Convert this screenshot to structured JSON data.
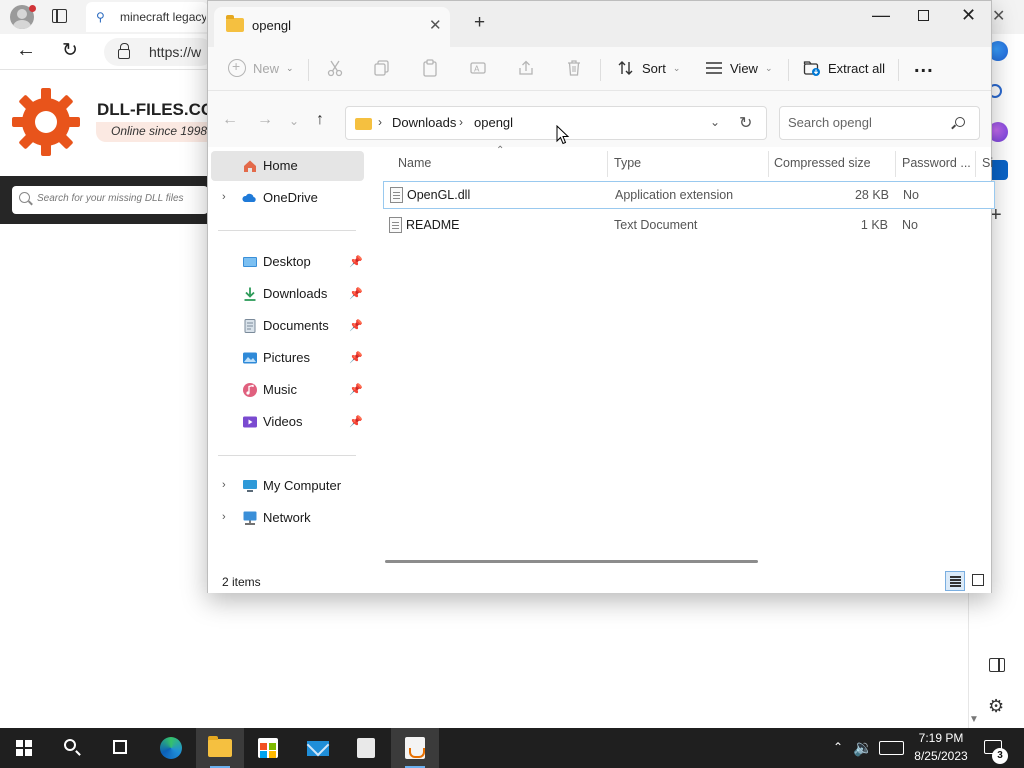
{
  "browser": {
    "tab_title": "minecraft legacy",
    "url": "https://w",
    "site": {
      "name": "DLL-FILES.COM",
      "tagline": "Online since 1998",
      "search_placeholder": "Search for your missing DLL files"
    }
  },
  "explorer": {
    "tab_title": "opengl",
    "toolbar": {
      "new_label": "New",
      "sort_label": "Sort",
      "view_label": "View",
      "extract_label": "Extract all",
      "more_label": "..."
    },
    "address": {
      "crumbs": [
        "Downloads",
        "opengl"
      ]
    },
    "search_placeholder": "Search opengl",
    "nav": {
      "home": "Home",
      "onedrive": "OneDrive",
      "quick_access": [
        {
          "label": "Desktop"
        },
        {
          "label": "Downloads"
        },
        {
          "label": "Documents"
        },
        {
          "label": "Pictures"
        },
        {
          "label": "Music"
        },
        {
          "label": "Videos"
        }
      ],
      "my_computer": "My Computer",
      "network": "Network"
    },
    "columns": {
      "name": "Name",
      "type": "Type",
      "compressed_size": "Compressed size",
      "password": "Password ...",
      "size_truncated": "Si"
    },
    "files": [
      {
        "name": "OpenGL.dll",
        "type": "Application extension",
        "compressed_size": "28 KB",
        "password": "No"
      },
      {
        "name": "README",
        "type": "Text Document",
        "compressed_size": "1 KB",
        "password": "No"
      }
    ],
    "status": "2 items"
  },
  "taskbar": {
    "time": "7:19 PM",
    "date": "8/25/2023",
    "notification_count": "3"
  },
  "colors": {
    "accent": "#0078d4",
    "folder": "#f5c040",
    "logo_orange": "#e8541b"
  }
}
